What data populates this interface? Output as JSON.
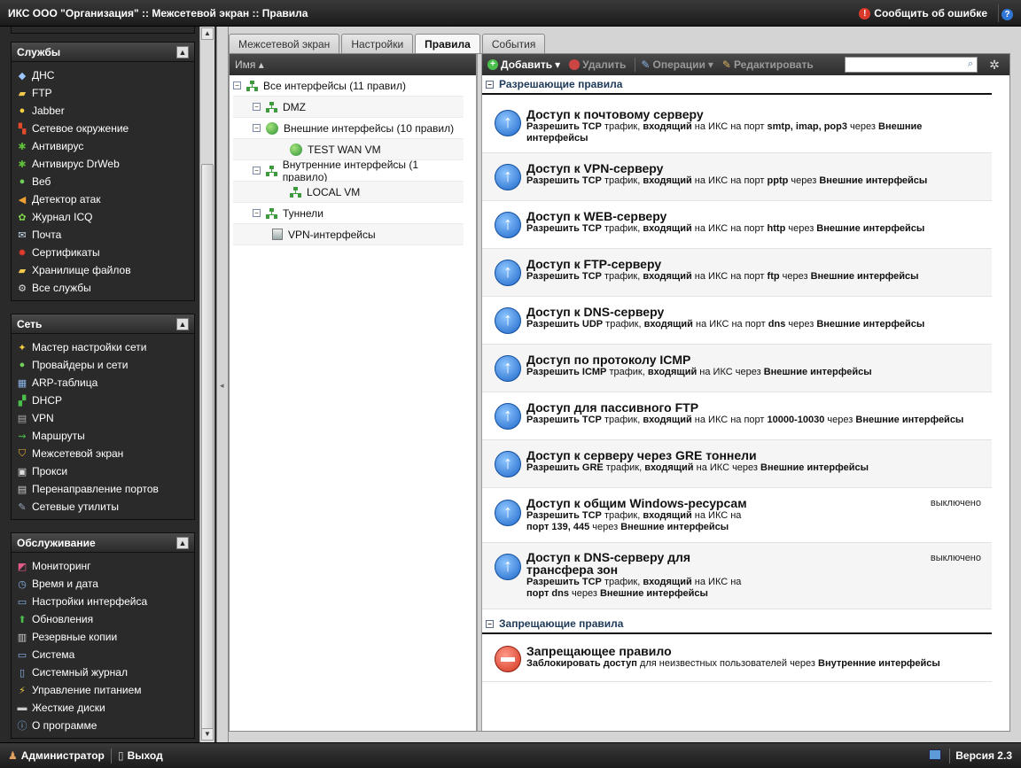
{
  "topbar": {
    "title": "ИКС ООО \"Организация\" :: Межсетевой экран :: Правила",
    "report_label": "Сообщить об ошибке"
  },
  "sidebar": {
    "panels": [
      {
        "title": "Службы",
        "items": [
          {
            "label": "ДНС",
            "icon": "tag-icon"
          },
          {
            "label": "FTP",
            "icon": "folder-icon"
          },
          {
            "label": "Jabber",
            "icon": "bulb-icon"
          },
          {
            "label": "Сетевое окружение",
            "icon": "windows-icon"
          },
          {
            "label": "Антивирус",
            "icon": "bug-icon"
          },
          {
            "label": "Антивирус DrWeb",
            "icon": "spider-icon"
          },
          {
            "label": "Веб",
            "icon": "globe-icon"
          },
          {
            "label": "Детектор атак",
            "icon": "megaphone-icon"
          },
          {
            "label": "Журнал ICQ",
            "icon": "flower-icon"
          },
          {
            "label": "Почта",
            "icon": "mail-icon"
          },
          {
            "label": "Сертификаты",
            "icon": "certificate-icon"
          },
          {
            "label": "Хранилище файлов",
            "icon": "folder-icon"
          },
          {
            "label": "Все службы",
            "icon": "gear-icon"
          }
        ]
      },
      {
        "title": "Сеть",
        "items": [
          {
            "label": "Мастер настройки сети",
            "icon": "wand-icon"
          },
          {
            "label": "Провайдеры и сети",
            "icon": "globe-icon"
          },
          {
            "label": "ARP-таблица",
            "icon": "table-icon"
          },
          {
            "label": "DHCP",
            "icon": "network-icon"
          },
          {
            "label": "VPN",
            "icon": "vpn-icon"
          },
          {
            "label": "Маршруты",
            "icon": "route-icon"
          },
          {
            "label": "Межсетевой экран",
            "icon": "shield-icon"
          },
          {
            "label": "Прокси",
            "icon": "proxy-icon"
          },
          {
            "label": "Перенаправление портов",
            "icon": "forward-icon"
          },
          {
            "label": "Сетевые утилиты",
            "icon": "wrench-icon"
          }
        ]
      },
      {
        "title": "Обслуживание",
        "items": [
          {
            "label": "Мониторинг",
            "icon": "chart-icon"
          },
          {
            "label": "Время и дата",
            "icon": "clock-icon"
          },
          {
            "label": "Настройки интерфейса",
            "icon": "window-icon"
          },
          {
            "label": "Обновления",
            "icon": "arrow-up-icon"
          },
          {
            "label": "Резервные копии",
            "icon": "database-icon"
          },
          {
            "label": "Система",
            "icon": "monitor-icon"
          },
          {
            "label": "Системный журнал",
            "icon": "book-icon"
          },
          {
            "label": "Управление питанием",
            "icon": "lightning-icon"
          },
          {
            "label": "Жесткие диски",
            "icon": "disk-icon"
          },
          {
            "label": "О программе",
            "icon": "info-icon"
          }
        ]
      }
    ]
  },
  "tabs": [
    {
      "label": "Межсетевой экран",
      "active": false
    },
    {
      "label": "Настройки",
      "active": false
    },
    {
      "label": "Правила",
      "active": true
    },
    {
      "label": "События",
      "active": false
    }
  ],
  "tree": {
    "header": "Имя ▴",
    "nodes": [
      {
        "label": "Все интерфейсы (11 правил)"
      },
      {
        "label": "DMZ"
      },
      {
        "label": "Внешние интерфейсы (10 правил)"
      },
      {
        "label": "TEST WAN VM"
      },
      {
        "label": "Внутренние интерфейсы (1 правило)"
      },
      {
        "label": "LOCAL VM"
      },
      {
        "label": "Туннели"
      },
      {
        "label": "VPN-интерфейсы"
      }
    ]
  },
  "toolbar": {
    "add": "Добавить",
    "delete": "Удалить",
    "operations": "Операции",
    "edit": "Редактировать",
    "search_placeholder": ""
  },
  "sections": {
    "allow": "Разрешающие правила",
    "deny": "Запрещающие правила"
  },
  "allow_rules": [
    {
      "title": "Доступ к почтовому серверу",
      "d1": "Разрешить TCP",
      "d2": " трафик, ",
      "d3": "входящий",
      "d4": " на ИКС на порт ",
      "d5": "smtp, imap, pop3",
      "d6": " через ",
      "d7": "Внешние интерфейсы",
      "status": ""
    },
    {
      "title": "Доступ к VPN-серверу",
      "d1": "Разрешить TCP",
      "d2": " трафик, ",
      "d3": "входящий",
      "d4": " на ИКС на порт ",
      "d5": "pptp",
      "d6": " через ",
      "d7": "Внешние интерфейсы",
      "status": ""
    },
    {
      "title": "Доступ к WEB-серверу",
      "d1": "Разрешить TCP",
      "d2": " трафик, ",
      "d3": "входящий",
      "d4": " на ИКС на порт ",
      "d5": "http",
      "d6": " через ",
      "d7": "Внешние интерфейсы",
      "status": ""
    },
    {
      "title": "Доступ к FTP-серверу",
      "d1": "Разрешить TCP",
      "d2": " трафик, ",
      "d3": "входящий",
      "d4": " на ИКС на порт ",
      "d5": "ftp",
      "d6": " через ",
      "d7": "Внешние интерфейсы",
      "status": ""
    },
    {
      "title": "Доступ к DNS-серверу",
      "d1": "Разрешить UDP",
      "d2": " трафик, ",
      "d3": "входящий",
      "d4": " на ИКС на порт ",
      "d5": "dns",
      "d6": " через ",
      "d7": "Внешние интерфейсы",
      "status": ""
    },
    {
      "title": "Доступ по протоколу ICMP",
      "d1": "Разрешить ICMP",
      "d2": " трафик, ",
      "d3": "входящий",
      "d4": " на ИКС ",
      "d5": "",
      "d6": "через ",
      "d7": "Внешние интерфейсы",
      "status": ""
    },
    {
      "title": "Доступ для пассивного FTP",
      "d1": "Разрешить TCP",
      "d2": " трафик, ",
      "d3": "входящий",
      "d4": " на ИКС на порт ",
      "d5": "10000-10030",
      "d6": " через ",
      "d7": "Внешние интерфейсы",
      "status": ""
    },
    {
      "title": "Доступ к серверу через GRE тоннели",
      "d1": "Разрешить GRE",
      "d2": " трафик, ",
      "d3": "входящий",
      "d4": " на ИКС ",
      "d5": "",
      "d6": "через ",
      "d7": "Внешние интерфейсы",
      "status": ""
    },
    {
      "title": "Доступ к общим Windows-ресурсам",
      "d1": "Разрешить TCP",
      "d2": " трафик, ",
      "d3": "входящий",
      "d4": " на ИКС на",
      "d5": "порт 139, 445",
      "d6": " через ",
      "d7": "Внешние интерфейсы",
      "status": "выключено"
    },
    {
      "title": "Доступ к DNS-серверу для трансфера зон",
      "d1": "Разрешить TCP",
      "d2": " трафик, ",
      "d3": "входящий",
      "d4": " на ИКС на",
      "d5": "порт dns",
      "d6": " через ",
      "d7": "Внешние интерфейсы",
      "status": "выключено"
    }
  ],
  "deny_rule": {
    "title": "Запрещающее правило",
    "d1": "Заблокировать доступ",
    "d2": " для неизвестных пользователей через ",
    "d3": "Внутренние интерфейсы"
  },
  "bottombar": {
    "user": "Администратор",
    "logout": "Выход",
    "version": "Версия 2.3"
  },
  "colors": {
    "bar_dark": "#1e1e1e",
    "allow_icon": "#1d66c9",
    "deny_icon": "#d2331c",
    "section_text": "#1e3a5a"
  }
}
